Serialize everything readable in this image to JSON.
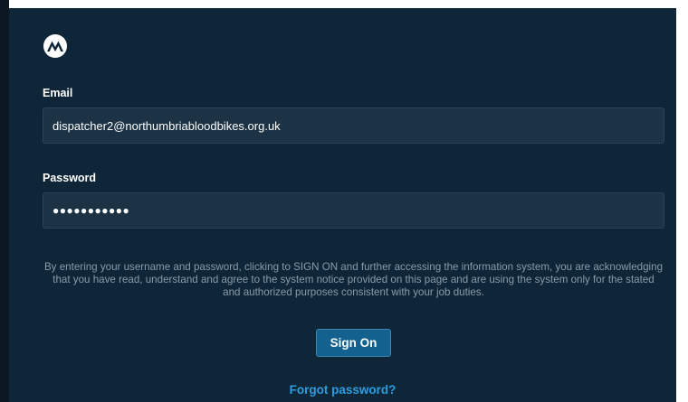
{
  "form": {
    "logo": "motorola-logo-icon",
    "email_label": "Email",
    "email_value": "dispatcher2@northumbriabloodbikes.org.uk",
    "password_label": "Password",
    "password_value": "●●●●●●●●●●●",
    "notice": "By entering your username and password, clicking to SIGN ON and further accessing the information system, you are acknowledging that you have read, understand and agree to the system notice provided on this page and are using the system only for the stated and authorized purposes consistent with your job duties.",
    "sign_on_label": "Sign On",
    "forgot_label": "Forgot password?"
  },
  "colors": {
    "panel_background": "#0e2637",
    "field_background": "#1b3344",
    "button_background": "#13618f",
    "link": "#2d9de0",
    "notice_text": "#8b9cab"
  }
}
